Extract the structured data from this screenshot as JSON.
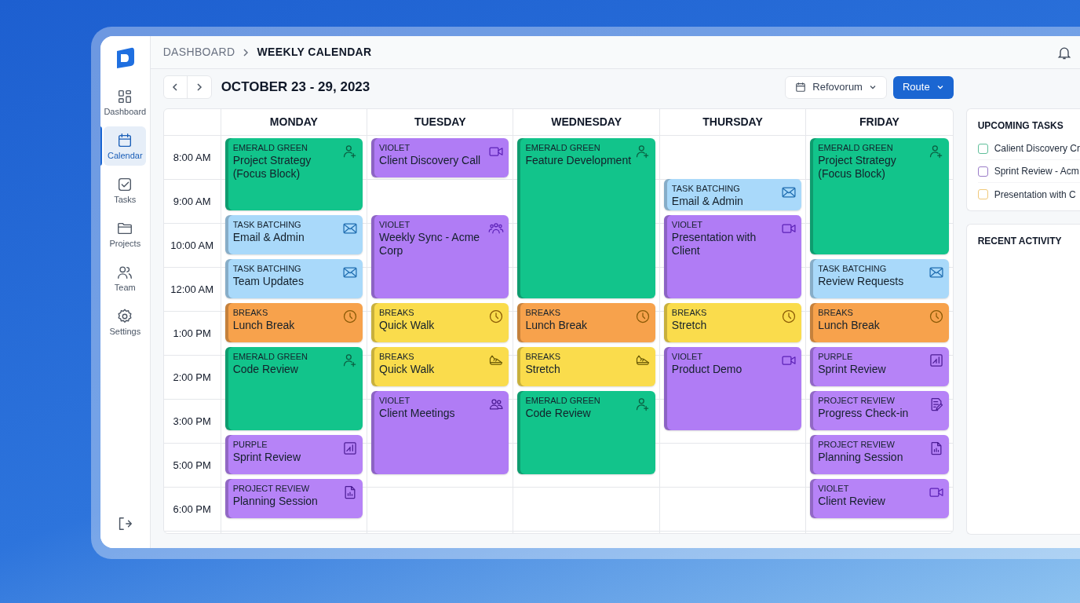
{
  "sidebar": {
    "items": [
      {
        "label": "Dashboard",
        "kind": "grid",
        "selected": false
      },
      {
        "label": "Calendar",
        "kind": "calendar",
        "selected": true
      },
      {
        "label": "Tasks",
        "kind": "check",
        "selected": false
      },
      {
        "label": "Projects",
        "kind": "folder",
        "selected": false
      },
      {
        "label": "Team",
        "kind": "people",
        "selected": false
      },
      {
        "label": "Settings",
        "kind": "gear",
        "selected": false
      }
    ]
  },
  "breadcrumb": [
    "DASHBOARD",
    "WEEKLY CALENDAR"
  ],
  "toolbar": {
    "range": "OCTOBER 23 - 29, 2023",
    "view_select": "Refovorum",
    "action_button": "Route"
  },
  "calendar": {
    "times": [
      "8:00 AM",
      "9:00 AM",
      "10:00 AM",
      "12:00 AM",
      "1:00 PM",
      "2:00 PM",
      "3:00 PM",
      "5:00 PM",
      "6:00 PM"
    ],
    "days": [
      {
        "name": "MONDAY",
        "events": [
          {
            "category": "EMERALD GREEN",
            "title": "Project Strategy (Focus Block)",
            "kind": "focus",
            "color": "#12c48b"
          },
          {
            "category": "TASK BATCHING",
            "title": "Email & Admin",
            "kind": "email",
            "color": "#a9d9fa"
          },
          {
            "category": "TASK BATCHING",
            "title": "Team Updates",
            "kind": "email",
            "color": "#a9d9fa"
          },
          {
            "category": "BREAKS",
            "title": "Lunch Break",
            "kind": "break",
            "color": "#f7a24c"
          },
          {
            "category": "EMERALD GREEN",
            "title": "Code Review",
            "kind": "focus",
            "color": "#12c48b"
          },
          {
            "category": "PURPLE",
            "title": "Sprint Review",
            "kind": "sprint",
            "color": "#b683f7"
          },
          {
            "category": "PROJECT REVIEW",
            "title": "Planning Session",
            "kind": "report",
            "color": "#b683f7"
          }
        ]
      },
      {
        "name": "TUESDAY",
        "events": [
          {
            "category": "VIOLET",
            "title": "Client Discovery Call",
            "kind": "call",
            "color": "#b07cf5"
          },
          {
            "category": "VIOLET",
            "title": "Weekly Sync - Acme Corp",
            "kind": "group",
            "color": "#b07cf5"
          },
          {
            "category": "BREAKS",
            "title": "Quick Walk",
            "kind": "break",
            "color": "#fadc4c"
          },
          {
            "category": "BREAKS",
            "title": "Quick Walk",
            "kind": "walk",
            "color": "#fadc4c"
          },
          {
            "category": "VIOLET",
            "title": "Client Meetings",
            "kind": "pair",
            "color": "#b07cf5"
          }
        ]
      },
      {
        "name": "WEDNESDAY",
        "events": [
          {
            "category": "EMERALD GREEN",
            "title": "Feature Development",
            "kind": "focus",
            "color": "#12c48b"
          },
          {
            "category": "BREAKS",
            "title": "Lunch Break",
            "kind": "break",
            "color": "#f7a24c"
          },
          {
            "category": "BREAKS",
            "title": "Stretch",
            "kind": "walk",
            "color": "#fadc4c"
          },
          {
            "category": "EMERALD GREEN",
            "title": "Code Review",
            "kind": "focus",
            "color": "#12c48b"
          }
        ]
      },
      {
        "name": "THURSDAY",
        "events": [
          {
            "category": "TASK BATCHING",
            "title": "Email & Admin",
            "kind": "email",
            "color": "#a9d9fa"
          },
          {
            "category": "VIOLET",
            "title": "Presentation with Client",
            "kind": "call",
            "color": "#b07cf5"
          },
          {
            "category": "BREAKS",
            "title": "Stretch",
            "kind": "break",
            "color": "#fadc4c"
          },
          {
            "category": "VIOLET",
            "title": "Product Demo",
            "kind": "call",
            "color": "#b07cf5"
          }
        ]
      },
      {
        "name": "FRIDAY",
        "events": [
          {
            "category": "EMERALD GREEN",
            "title": "Project Strategy (Focus Block)",
            "kind": "focus",
            "color": "#12c48b"
          },
          {
            "category": "TASK BATCHING",
            "title": "Review Requests",
            "kind": "email",
            "color": "#a9d9fa"
          },
          {
            "category": "BREAKS",
            "title": "Lunch Break",
            "kind": "break",
            "color": "#f7a24c"
          },
          {
            "category": "PURPLE",
            "title": "Sprint Review",
            "kind": "sprint",
            "color": "#b683f7"
          },
          {
            "category": "PROJECT REVIEW",
            "title": "Progress Check-in",
            "kind": "checkin",
            "color": "#b683f7"
          },
          {
            "category": "PROJECT REVIEW",
            "title": "Planning Session",
            "kind": "report",
            "color": "#b683f7"
          },
          {
            "category": "VIOLET",
            "title": "Client Review",
            "kind": "call",
            "color": "#b683f7"
          }
        ]
      }
    ]
  },
  "upcoming_tasks": {
    "title": "UPCOMING TASKS",
    "items": [
      {
        "label": "Calient Discovery Cr",
        "checked": false,
        "color": "#5fbf9a"
      },
      {
        "label": "Sprint Review - Acm",
        "checked": false,
        "color": "#9a7cc8"
      },
      {
        "label": "Presentation with C",
        "checked": false,
        "color": "#f0c97a"
      }
    ]
  },
  "recent_activity": {
    "title": "RECENT ACTIVITY"
  }
}
